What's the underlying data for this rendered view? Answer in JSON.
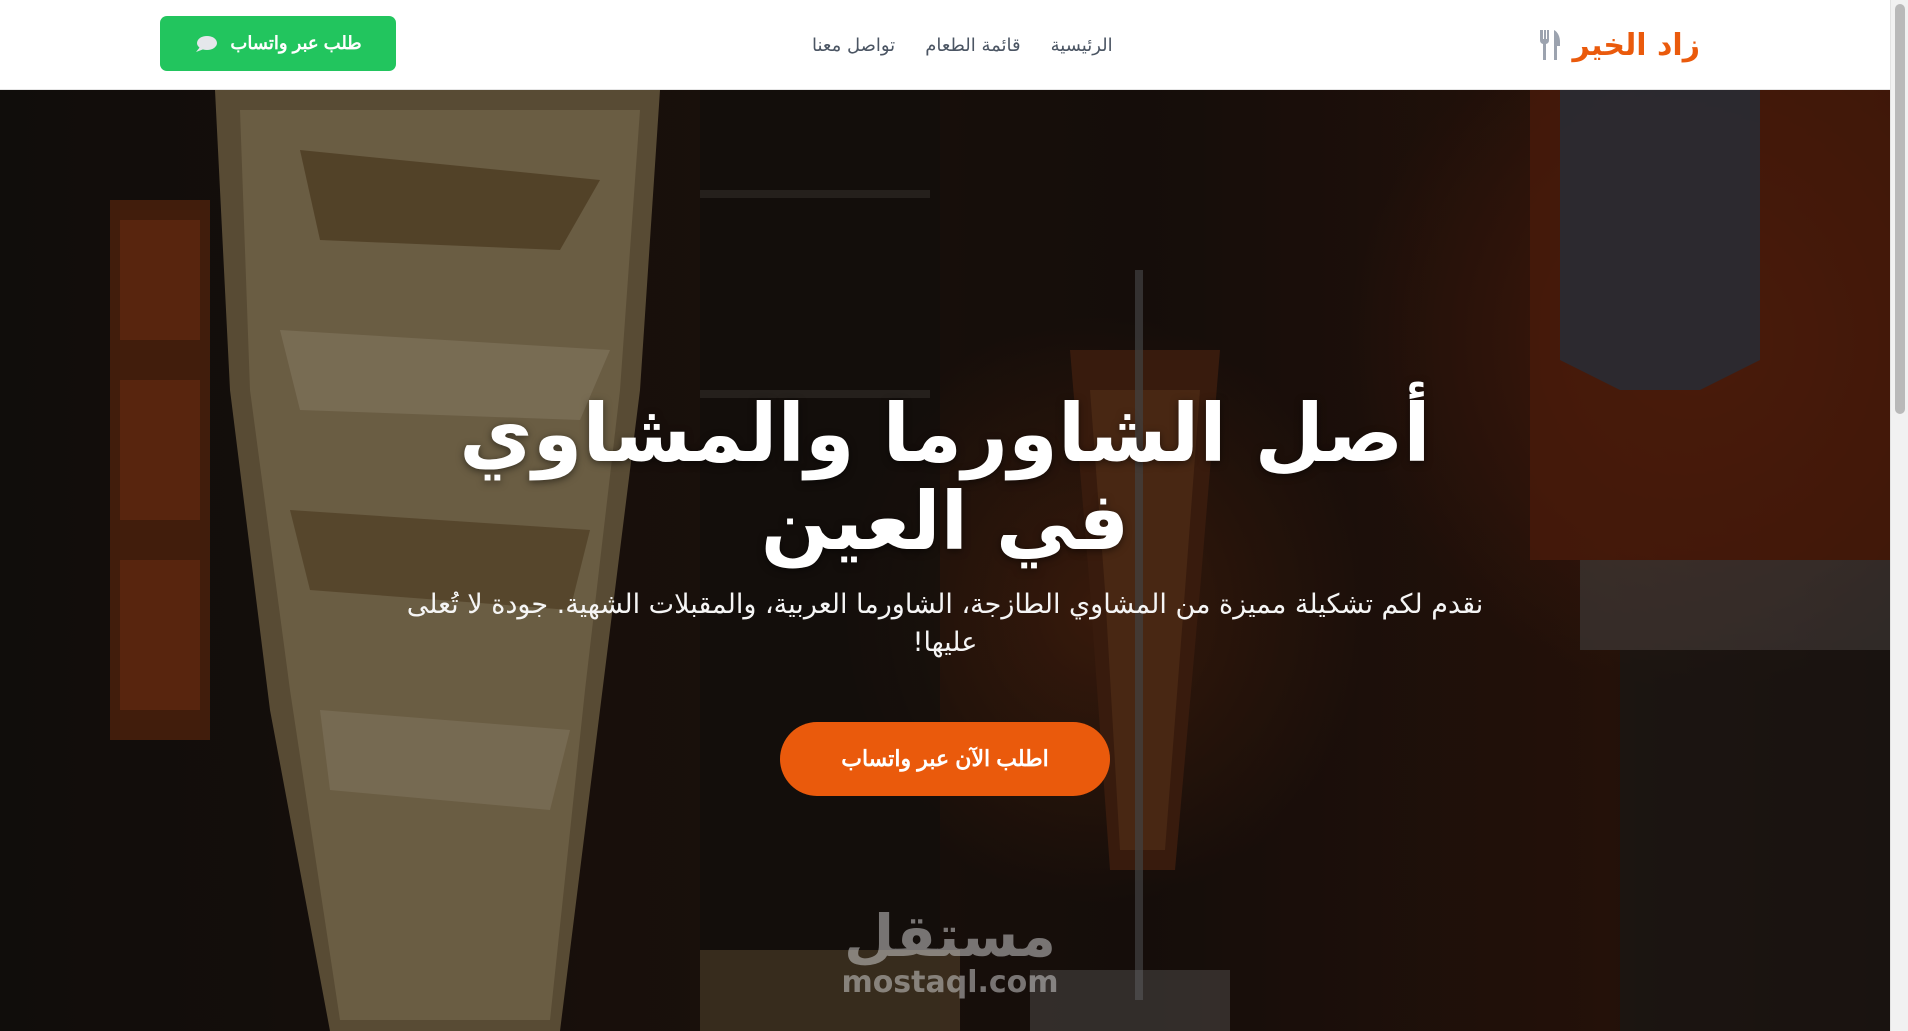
{
  "brand": {
    "name": "زاد الخير",
    "icon": "utensils-icon",
    "color": "#ea5a0c"
  },
  "nav": {
    "links": [
      "الرئيسية",
      "قائمة الطعام",
      "تواصل معنا"
    ],
    "cta_label": "طلب عبر واتساب",
    "cta_icon": "chat-bubble-icon",
    "cta_color": "#22c55e"
  },
  "hero": {
    "title": "أصل الشاورما والمشاوي في العين",
    "subtitle": "نقدم لكم تشكيلة مميزة من المشاوي الطازجة، الشاورما العربية، والمقبلات الشهية. جودة لا تُعلى عليها!",
    "cta_label": "اطلب الآن عبر واتساب",
    "cta_color": "#ea5a0c"
  },
  "watermark": {
    "arabic": "مستقل",
    "latin": "mostaql.com"
  }
}
